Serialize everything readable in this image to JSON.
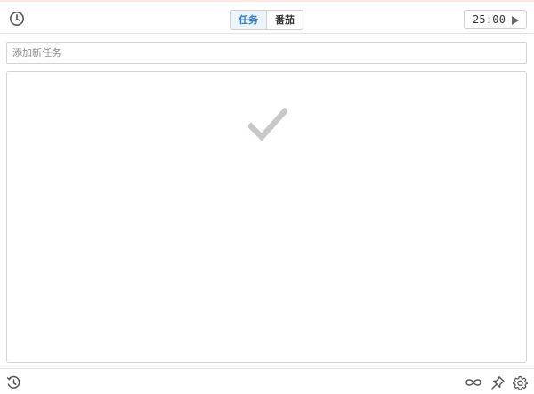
{
  "header": {
    "tabs": [
      {
        "label": "任务",
        "active": true
      },
      {
        "label": "番茄",
        "active": false
      }
    ],
    "timer": {
      "value": "25:00"
    }
  },
  "task_input": {
    "placeholder": "添加新任务",
    "value": ""
  },
  "task_list": {
    "empty_icon": "checkmark-icon",
    "items": []
  },
  "icons": {
    "header_left": "clock-icon",
    "timer_action": "play-icon",
    "footer_left": "history-icon",
    "footer_right": [
      "infinity-icon",
      "pin-icon",
      "gear-icon"
    ]
  },
  "colors": {
    "accent": "#2a7fd4",
    "active_tab_bg": "#eef4fb",
    "border": "#d2d2d2",
    "empty_check": "#c8c8c8"
  }
}
